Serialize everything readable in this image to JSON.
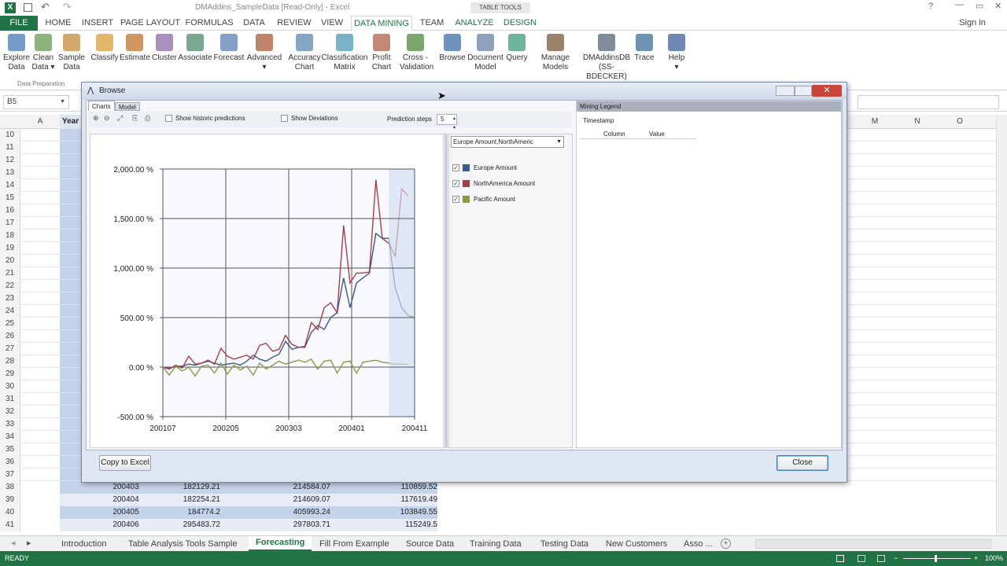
{
  "window": {
    "title": "DMAddins_SampleData  [Read-Only] - Excel",
    "table_tools": "TABLE TOOLS",
    "signin": "Sign in"
  },
  "tabs": [
    "FILE",
    "HOME",
    "INSERT",
    "PAGE LAYOUT",
    "FORMULAS",
    "DATA",
    "REVIEW",
    "VIEW",
    "DATA MINING",
    "TEAM",
    "ANALYZE",
    "DESIGN"
  ],
  "ribbon": {
    "buttons": [
      {
        "l1": "Explore",
        "l2": "Data",
        "icon": "explore-data-icon"
      },
      {
        "l1": "Clean",
        "l2": "Data ▾",
        "icon": "clean-data-icon"
      },
      {
        "l1": "Sample",
        "l2": "Data",
        "icon": "sample-data-icon"
      },
      {
        "l1": "Classify",
        "l2": "",
        "icon": "classify-icon"
      },
      {
        "l1": "Estimate",
        "l2": "",
        "icon": "estimate-icon"
      },
      {
        "l1": "Cluster",
        "l2": "",
        "icon": "cluster-icon"
      },
      {
        "l1": "Associate",
        "l2": "",
        "icon": "associate-icon"
      },
      {
        "l1": "Forecast",
        "l2": "",
        "icon": "forecast-icon"
      },
      {
        "l1": "Advanced",
        "l2": "▾",
        "icon": "advanced-icon"
      },
      {
        "l1": "Accuracy",
        "l2": "Chart",
        "icon": "accuracy-chart-icon"
      },
      {
        "l1": "Classification",
        "l2": "Matrix",
        "icon": "classification-matrix-icon"
      },
      {
        "l1": "Profit",
        "l2": "Chart",
        "icon": "profit-chart-icon"
      },
      {
        "l1": "Cross -",
        "l2": "Validation",
        "icon": "cross-validation-icon"
      },
      {
        "l1": "Browse",
        "l2": "",
        "icon": "browse-icon"
      },
      {
        "l1": "Document",
        "l2": "Model",
        "icon": "document-model-icon"
      },
      {
        "l1": "Query",
        "l2": "",
        "icon": "query-icon"
      },
      {
        "l1": "Manage",
        "l2": "Models",
        "icon": "manage-models-icon"
      },
      {
        "l1": "DMAddinsDB",
        "l2": "(SS-BDECKER)",
        "icon": "connection-icon"
      },
      {
        "l1": "Trace",
        "l2": "",
        "icon": "trace-icon"
      },
      {
        "l1": "Help",
        "l2": "▾",
        "icon": "help-icon"
      }
    ],
    "group_label": "Data Preparation"
  },
  "namebox": "B5",
  "columns_left": [
    "A",
    "Year"
  ],
  "columns_right": [
    "M",
    "N",
    "O"
  ],
  "rows_top": [
    "10",
    "11",
    "12",
    "13",
    "14",
    "15",
    "16",
    "17",
    "18",
    "19",
    "20",
    "21",
    "22",
    "23",
    "24",
    "25",
    "26",
    "27",
    "28",
    "29",
    "30",
    "31",
    "32",
    "33",
    "34",
    "35",
    "36",
    "37"
  ],
  "data_rows": [
    {
      "row": "38",
      "year": "200403",
      "c": "182129.21",
      "d": "214584.07",
      "e": "110859.52"
    },
    {
      "row": "39",
      "year": "200404",
      "c": "182254.21",
      "d": "214609.07",
      "e": "117619.49"
    },
    {
      "row": "40",
      "year": "200405",
      "c": "184774.2",
      "d": "405993.24",
      "e": "103849.55"
    },
    {
      "row": "41",
      "year": "200406",
      "c": "295483.72",
      "d": "297803.71",
      "e": "115249.5"
    }
  ],
  "sheet_tabs": [
    "Introduction",
    "Table Analysis Tools Sample",
    "Forecasting",
    "Fill From Example",
    "Source Data",
    "Training Data",
    "Testing Data",
    "New Customers",
    "Asso ..."
  ],
  "active_sheet": "Forecasting",
  "status": {
    "left": "READY",
    "zoom": "100%"
  },
  "dialog": {
    "title": "Browse",
    "tabs": [
      "Charts",
      "Model"
    ],
    "show_historic": "Show historic predictions",
    "show_deviations": "Show Deviations",
    "prediction_steps_label": "Prediction steps",
    "prediction_steps_value": "5",
    "series_dropdown": "Europe Amount,NorthAmeric",
    "legend_title": "Mining Legend",
    "legend_timestamp": "Timestamp",
    "legend_col_column": "Column",
    "legend_col_value": "Value",
    "copy_button": "Copy to Excel",
    "close_button": "Close"
  },
  "chart_data": {
    "type": "line",
    "y_ticks": [
      "2,000.00 %",
      "1,500.00 %",
      "1,000.00 %",
      "500.00 %",
      "0.00 %",
      "-500.00 %"
    ],
    "ylim": [
      -500,
      2000
    ],
    "x_ticks": [
      "200107",
      "200205",
      "200303",
      "200401",
      "200411"
    ],
    "prediction_region_start_index": 35,
    "series": [
      {
        "name": "Europe Amount",
        "color": "#3a5a8c",
        "checked": true,
        "values": [
          0,
          -10,
          5,
          10,
          30,
          20,
          40,
          60,
          40,
          20,
          30,
          40,
          20,
          60,
          120,
          80,
          60,
          100,
          130,
          260,
          180,
          200,
          200,
          350,
          420,
          380,
          500,
          550,
          900,
          600,
          850,
          900,
          950,
          1350,
          1300,
          1300,
          800,
          600,
          520,
          500
        ]
      },
      {
        "name": "NorthAmerica Amount",
        "color": "#a0404a",
        "checked": true,
        "values": [
          0,
          -20,
          20,
          -10,
          110,
          30,
          40,
          70,
          30,
          190,
          110,
          80,
          100,
          120,
          80,
          220,
          240,
          160,
          180,
          320,
          230,
          200,
          210,
          450,
          380,
          600,
          650,
          550,
          1430,
          850,
          950,
          950,
          960,
          1890,
          1300,
          1250,
          1120,
          1800,
          1730
        ]
      },
      {
        "name": "Pacific Amount",
        "color": "#8a9a4a",
        "checked": true,
        "values": [
          0,
          -80,
          10,
          -40,
          0,
          -90,
          10,
          20,
          -60,
          40,
          -70,
          20,
          -30,
          10,
          -80,
          40,
          -20,
          20,
          60,
          30,
          50,
          70,
          50,
          80,
          -20,
          60,
          70,
          -60,
          50,
          60,
          -60,
          50,
          60,
          70,
          50,
          40,
          30,
          30,
          30
        ]
      }
    ]
  }
}
